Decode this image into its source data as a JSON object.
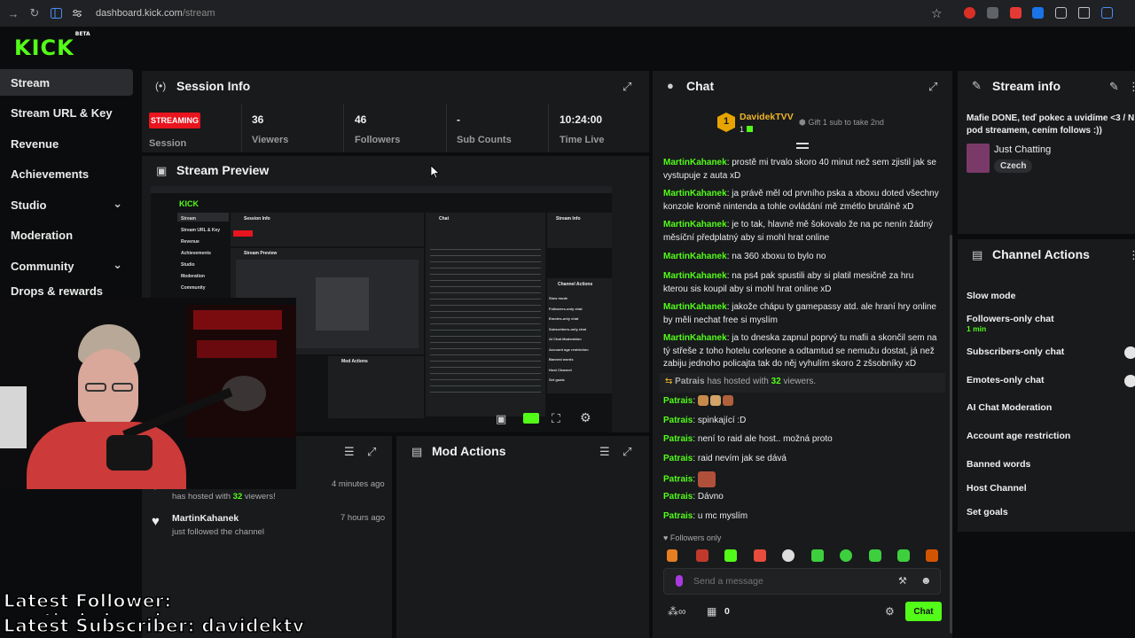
{
  "browser": {
    "url_domain": "dashboard.kick.com",
    "url_path": "/stream"
  },
  "brand": {
    "logo": "KICK",
    "logo_badge": "BETA",
    "accent": "#53fc18"
  },
  "sidebar": {
    "items": [
      {
        "label": "Stream",
        "active": true
      },
      {
        "label": "Stream URL & Key"
      },
      {
        "label": "Revenue"
      },
      {
        "label": "Achievements"
      },
      {
        "label": "Studio",
        "expandable": true
      },
      {
        "label": "Moderation"
      },
      {
        "label": "Community",
        "expandable": true
      },
      {
        "label": "Drops & rewards"
      }
    ]
  },
  "session_info": {
    "title": "Session Info",
    "status_badge": "STREAMING",
    "status_label": "Session",
    "stats": [
      {
        "value": "36",
        "label": "Viewers"
      },
      {
        "value": "46",
        "label": "Followers"
      },
      {
        "value": "-",
        "label": "Sub Counts"
      },
      {
        "value": "10:24:00",
        "label": "Time Live"
      }
    ]
  },
  "stream_preview": {
    "title": "Stream Preview"
  },
  "activity": {
    "items": [
      {
        "text": "has hosted with ",
        "count": "32",
        "suffix": " viewers!",
        "time": "4 minutes ago"
      },
      {
        "user": "MartinKahanek",
        "text": "just followed the channel",
        "time": "7 hours ago"
      }
    ]
  },
  "mod_actions": {
    "title": "Mod Actions"
  },
  "chat": {
    "title": "Chat",
    "pinned_user": "DavidekTVV",
    "pinned_rank": "1",
    "pinned_count": "1",
    "gift_text": "Gift 1 sub to take 2nd",
    "messages": [
      {
        "user": "MartinKahanek",
        "text": "prostě mi trvalo skoro 40 minut než sem zjistil jak se vystupuje z auta xD"
      },
      {
        "user": "MartinKahanek",
        "text": "ja právě měl od prvního pska a xboxu doted všechny konzole kromě nintenda a tohle ovládání mě zmétlo brutálně xD"
      },
      {
        "user": "MartinKahanek",
        "text": "je to tak, hlavně mě šokovalo že na pc nenín žádný měsíční předplatný aby si mohl hrat online"
      },
      {
        "user": "MartinKahanek",
        "text": "na 360 xboxu to bylo no"
      },
      {
        "user": "MartinKahanek",
        "text": "na ps4 pak spustili aby si platil mesičně za hru kterou sis koupil aby si mohl hrat online xD"
      },
      {
        "user": "MartinKahanek",
        "text": "jakože chápu ty gamepassy atd. ale hraní hry online by měli nechat free si myslím"
      },
      {
        "user": "MartinKahanek",
        "text": "ja to dneska zapnul poprvý tu mafii a skončil sem na tý střeše z toho hotelu corleone a odtamtud se nemužu dostat, já než zabiju jednoho policajta tak do něj vyhulím skoro 2 zšsobníky xD"
      }
    ],
    "host_notice": {
      "user": "Patrais",
      "text": "has hosted with",
      "count": "32",
      "suffix": "viewers."
    },
    "short_messages": [
      {
        "user": "Patrais",
        "text": ""
      },
      {
        "user": "Patrais",
        "text": "spinkající :D"
      },
      {
        "user": "Patrais",
        "text": "není to raid ale host.. možná proto"
      },
      {
        "user": "Patrais",
        "text": "raid nevím jak se dává"
      },
      {
        "user": "Patrais",
        "text": ""
      },
      {
        "user": "Patrais",
        "text": "Dávno"
      },
      {
        "user": "Patrais",
        "text": "u mc myslím"
      }
    ],
    "followers_only": "Followers only",
    "input_placeholder": "Send a message",
    "points": "0",
    "send_label": "Chat"
  },
  "stream_info": {
    "title": "Stream info",
    "stream_title": "Mafie DONE, teď pokec a uvidíme <3 / N pod streamem, cením follows :))",
    "category": "Just Chatting",
    "tag": "Czech"
  },
  "channel_actions": {
    "title": "Channel Actions",
    "items": [
      {
        "label": "Slow mode"
      },
      {
        "label": "Followers-only chat",
        "sub": "1 min"
      },
      {
        "label": "Subscribers-only chat",
        "toggle": true
      },
      {
        "label": "Emotes-only chat",
        "toggle": true
      },
      {
        "label": "AI Chat Moderation"
      },
      {
        "label": "Account age restriction"
      },
      {
        "label": "Banned words"
      },
      {
        "label": "Host Channel"
      },
      {
        "label": "Set goals"
      }
    ]
  },
  "overlay": {
    "latest_follower": "Latest Follower:",
    "latest_follower_name": "martin kahanek",
    "latest_subscriber": "Latest Subscriber: davidektv"
  },
  "preview_mini": {
    "logo": "KICK",
    "panels": [
      "Session Info",
      "Chat",
      "Stream Info",
      "Stream Preview",
      "Mod Actions",
      "Channel Actions"
    ],
    "menu": [
      "Stream",
      "Stream URL & Key",
      "Revenue",
      "Achievements",
      "Studio",
      "Moderation",
      "Community"
    ],
    "actions": [
      "Slow mode",
      "Followers-only chat",
      "Emotes-only chat",
      "Subscribers-only chat",
      "AI Chat Moderation",
      "Account age restriction",
      "Banned words",
      "Host Channel",
      "Set goals"
    ]
  }
}
